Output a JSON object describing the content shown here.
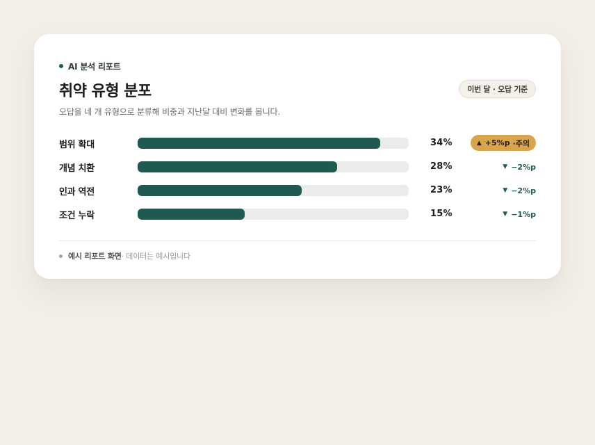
{
  "header": {
    "eyebrow": "AI 분석 리포트",
    "title": "취약 유형 분포",
    "period_badge": "이번 달 · 오답 기준",
    "subtitle": "오답을 네 개 유형으로 분류해 비중과 지난달 대비 변화를 봅니다."
  },
  "chart_data": {
    "type": "bar",
    "orientation": "horizontal",
    "categories": [
      "범위 확대",
      "개념 치환",
      "인과 역전",
      "조건 누락"
    ],
    "values": [
      34,
      28,
      23,
      15
    ],
    "unit": "%",
    "xlim": [
      0,
      38
    ],
    "changes": [
      "+5%p",
      "−2%p",
      "−2%p",
      "−1%p"
    ],
    "change_flag": [
      "주의",
      "",
      "",
      ""
    ]
  },
  "rows": [
    {
      "label": "범위 확대",
      "pct": "34%",
      "change": "+5%p",
      "note": "·주의",
      "direction": "up",
      "icon": "triangle-up-icon",
      "warn": true
    },
    {
      "label": "개념 치환",
      "pct": "28%",
      "change": "−2%p",
      "note": "",
      "direction": "down",
      "icon": "triangle-down-icon",
      "warn": false
    },
    {
      "label": "인과 역전",
      "pct": "23%",
      "change": "−2%p",
      "note": "",
      "direction": "down",
      "icon": "triangle-down-icon",
      "warn": false
    },
    {
      "label": "조건 누락",
      "pct": "15%",
      "change": "−1%p",
      "note": "",
      "direction": "down",
      "icon": "triangle-down-icon",
      "warn": false
    }
  ],
  "footer": {
    "strong": "예시 리포트 화면",
    "muted": " · 데이터는 예시입니다"
  },
  "colors": {
    "accent": "#1f5a52",
    "warning": "#d8a44e",
    "track": "#e9eceb",
    "background": "#f3efe7"
  }
}
